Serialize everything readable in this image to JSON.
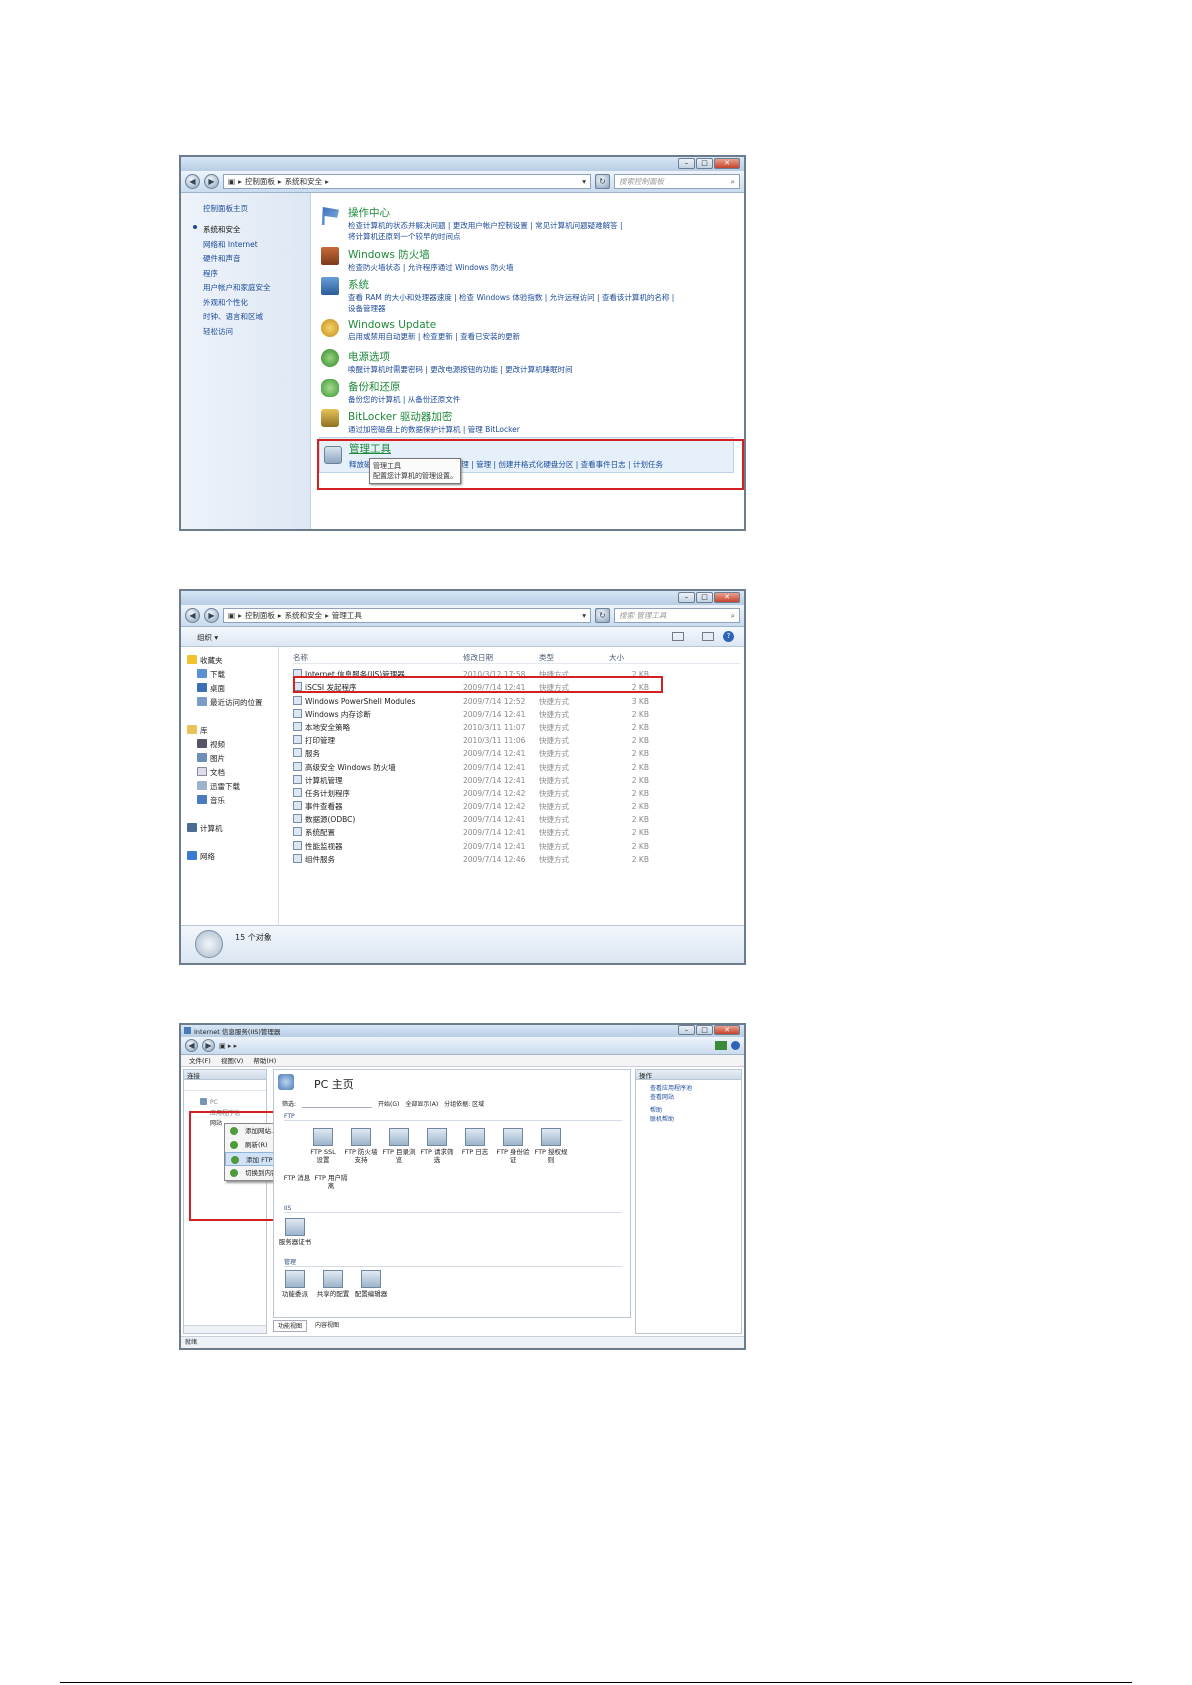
{
  "win1": {
    "breadcrumb": [
      "控制面板",
      "系统和安全"
    ],
    "search_placeholder": "搜索控制面板",
    "nav_home": "控制面板主页",
    "nav": [
      "系统和安全",
      "网络和 Internet",
      "硬件和声音",
      "程序",
      "用户帐户和家庭安全",
      "外观和个性化",
      "时钟、语言和区域",
      "轻松访问"
    ],
    "groups": [
      {
        "title": "操作中心",
        "line1": "检查计算机的状态并解决问题 | 更改用户帐户控制设置 | 常见计算机问题疑难解答 |",
        "line2": "将计算机还原到一个较早的时间点",
        "icon": "flag-icon"
      },
      {
        "title": "Windows 防火墙",
        "line1": "检查防火墙状态 | 允许程序通过 Windows 防火墙",
        "line2": "",
        "icon": "firewall-icon"
      },
      {
        "title": "系统",
        "line1": "查看 RAM 的大小和处理器速度 | 检查 Windows 体验指数 | 允许远程访问 | 查看该计算机的名称 |",
        "line2": "设备管理器",
        "icon": "computer-icon"
      },
      {
        "title": "Windows Update",
        "line1": "启用或禁用自动更新 | 检查更新 | 查看已安装的更新",
        "line2": "",
        "icon": "update-icon"
      },
      {
        "title": "电源选项",
        "line1": "唤醒计算机时需要密码 | 更改电源按钮的功能 | 更改计算机睡眠时间",
        "line2": "",
        "icon": "power-icon"
      },
      {
        "title": "备份和还原",
        "line1": "备份您的计算机 | 从备份还原文件",
        "line2": "",
        "icon": "backup-icon"
      },
      {
        "title": "BitLocker 驱动器加密",
        "line1": "通过加密磁盘上的数据保护计算机 | 管理 BitLocker",
        "line2": "",
        "icon": "bitlocker-icon"
      }
    ],
    "admin": {
      "title": "管理工具",
      "links": "释放磁盘空间 | 对硬盘进行碎片整理 | 管理 | 创建并格式化硬盘分区 | 查看事件日志 | 计划任务",
      "tooltip_title": "管理工具",
      "tooltip_desc": "配置您计算机的管理设置。"
    }
  },
  "win2": {
    "breadcrumb": [
      "控制面板",
      "系统和安全",
      "管理工具"
    ],
    "search_placeholder": "搜索 管理工具",
    "organize": "组织 ▾",
    "sidebar": {
      "favorites": "收藏夹",
      "fav_items": [
        "下载",
        "桌面",
        "最近访问的位置"
      ],
      "libraries": "库",
      "lib_items": [
        "视频",
        "图片",
        "文档",
        "迅雷下载",
        "音乐"
      ],
      "computer": "计算机",
      "network": "网络"
    },
    "headers": [
      "名称",
      "修改日期",
      "类型",
      "大小"
    ],
    "rows": [
      [
        "Internet 信息服务(IIS)管理器",
        "2010/3/12 17:58",
        "快捷方式",
        "2 KB"
      ],
      [
        "iSCSI 发起程序",
        "2009/7/14 12:41",
        "快捷方式",
        "2 KB"
      ],
      [
        "Windows PowerShell Modules",
        "2009/7/14 12:52",
        "快捷方式",
        "3 KB"
      ],
      [
        "Windows 内存诊断",
        "2009/7/14 12:41",
        "快捷方式",
        "2 KB"
      ],
      [
        "本地安全策略",
        "2010/3/11 11:07",
        "快捷方式",
        "2 KB"
      ],
      [
        "打印管理",
        "2010/3/11 11:06",
        "快捷方式",
        "2 KB"
      ],
      [
        "服务",
        "2009/7/14 12:41",
        "快捷方式",
        "2 KB"
      ],
      [
        "高级安全 Windows 防火墙",
        "2009/7/14 12:41",
        "快捷方式",
        "2 KB"
      ],
      [
        "计算机管理",
        "2009/7/14 12:41",
        "快捷方式",
        "2 KB"
      ],
      [
        "任务计划程序",
        "2009/7/14 12:42",
        "快捷方式",
        "2 KB"
      ],
      [
        "事件查看器",
        "2009/7/14 12:42",
        "快捷方式",
        "2 KB"
      ],
      [
        "数据源(ODBC)",
        "2009/7/14 12:41",
        "快捷方式",
        "2 KB"
      ],
      [
        "系统配置",
        "2009/7/14 12:41",
        "快捷方式",
        "2 KB"
      ],
      [
        "性能监视器",
        "2009/7/14 12:41",
        "快捷方式",
        "2 KB"
      ],
      [
        "组件服务",
        "2009/7/14 12:46",
        "快捷方式",
        "2 KB"
      ]
    ],
    "status": "15 个对象"
  },
  "win3": {
    "title": "Internet 信息服务(IIS)管理器",
    "menu": [
      "文件(F)",
      "视图(V)",
      "帮助(H)"
    ],
    "conn_header": "连接",
    "home_title": "PC 主页",
    "filter_label": "筛选:",
    "filter_go": "开始(G)",
    "filter_showall": "全部显示(A)",
    "group_label": "分组依据: 区域",
    "section_ftp": "FTP",
    "ftp_icons": [
      "FTP SSL 设置",
      "FTP 防火墙支持",
      "FTP 目录浏览",
      "FTP 请求筛选",
      "FTP 日志",
      "FTP 身份验证",
      "FTP 授权规则"
    ],
    "ftp_row2": [
      "FTP 消息",
      "FTP 用户隔离"
    ],
    "section_iis": "IIS",
    "iis_icons": [
      "服务器证书"
    ],
    "section_mgmt": "管理",
    "mgmt_icons": [
      "功能委派",
      "共享的配置",
      "配置编辑器"
    ],
    "actions_header": "操作",
    "actions": [
      "查看应用程序池",
      "查看网站",
      "帮助",
      "联机帮助"
    ],
    "context_menu": [
      "添加网站...",
      "刷新(R)",
      "添加 FTP 站点...",
      "切换到内容视图"
    ],
    "tree": [
      "应用程序池",
      "网站"
    ],
    "tabs": [
      "功能视图",
      "内容视图"
    ],
    "statusbar": "就绪"
  }
}
